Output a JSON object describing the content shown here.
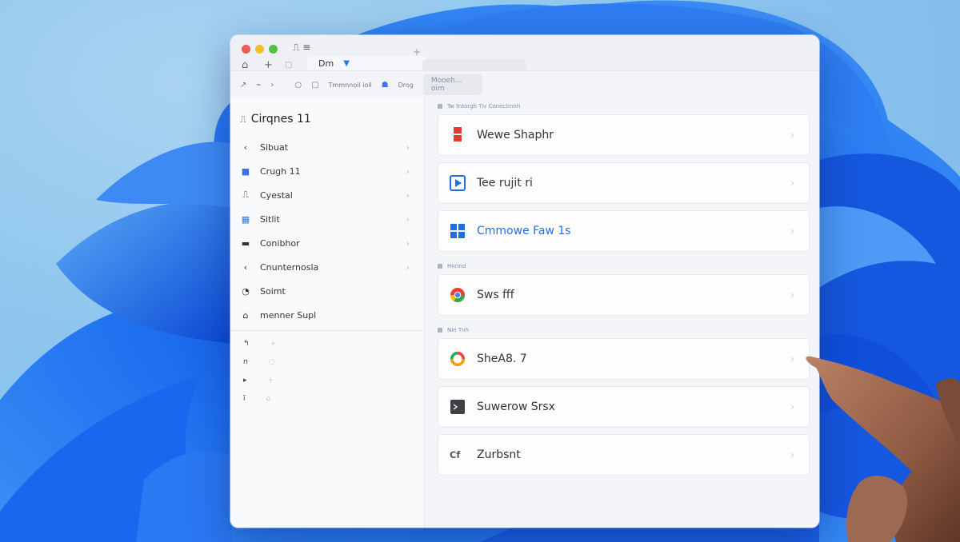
{
  "window": {
    "tab_label": "Dm"
  },
  "toolbar": {
    "items": [
      "↗",
      "⌁",
      "›",
      "○",
      "▢",
      "Tmmnnoil ioil",
      "☗",
      "Drog"
    ],
    "address": "Mooeh... oim"
  },
  "sidebar": {
    "title": "Cirqnes 11",
    "items": [
      {
        "icon": "back-icon",
        "glyph": "‹",
        "label": "Sibuat"
      },
      {
        "icon": "windows-icon",
        "glyph": "■",
        "label": "Crugh 11"
      },
      {
        "icon": "document-icon",
        "glyph": "⎍",
        "label": "Cyestal"
      },
      {
        "icon": "grid-icon",
        "glyph": "▦",
        "label": "Sitlit"
      },
      {
        "icon": "monitor-icon",
        "glyph": "▬",
        "label": "Conibhor"
      },
      {
        "icon": "back-icon",
        "glyph": "‹",
        "label": "Cnunternosla"
      },
      {
        "icon": "clock-icon",
        "glyph": "◔",
        "label": "Soimt"
      },
      {
        "icon": "home-icon",
        "glyph": "⌂",
        "label": "menner Supl"
      }
    ],
    "small_rows": [
      {
        "a": "↰",
        "b": "+"
      },
      {
        "a": "п",
        "b": "○"
      },
      {
        "a": "▸",
        "b": "+"
      },
      {
        "a": "ĭ",
        "b": "⌂"
      }
    ]
  },
  "main": {
    "sections": [
      {
        "label": "Tw tntorgh Tiv Conectinnh",
        "cards": [
          {
            "icon": "red-app-icon",
            "label": "Wewe Shaphr",
            "style": ""
          },
          {
            "icon": "play-icon",
            "label": "Tee rujit ri",
            "style": ""
          },
          {
            "icon": "windows-icon",
            "label": "Cmmowe Faw 1s",
            "style": "blue"
          }
        ]
      },
      {
        "label": "Hnrind",
        "cards": [
          {
            "icon": "chrome-icon",
            "label": "Sws fff",
            "style": ""
          }
        ]
      },
      {
        "label": "Nin Tnh",
        "cards": [
          {
            "icon": "ring-icon",
            "label": "SheA8. 7",
            "style": ""
          },
          {
            "icon": "terminal-icon",
            "label": "Suwerow Srsx",
            "style": ""
          },
          {
            "icon": "cf-logo-icon",
            "label": "Zurbsnt",
            "style": ""
          }
        ]
      }
    ]
  },
  "colors": {
    "accent": "#2a6fd8",
    "wallpaper_blue": "#1a63e8"
  }
}
